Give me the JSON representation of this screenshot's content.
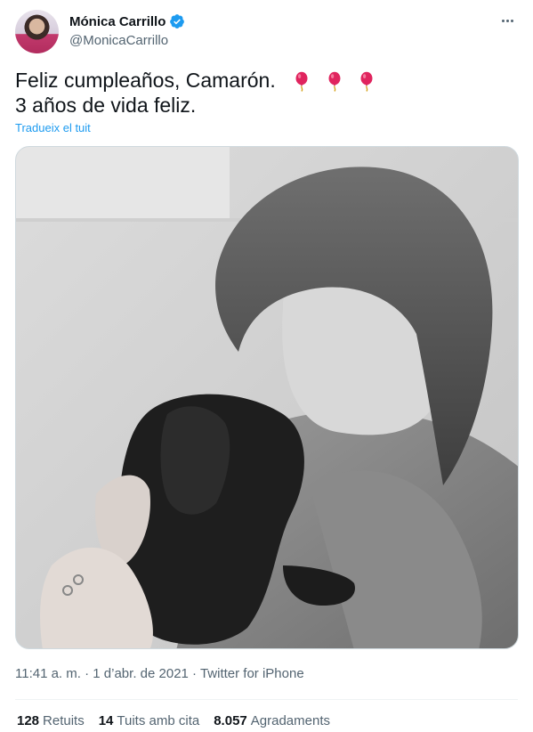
{
  "author": {
    "display_name": "Mónica Carrillo",
    "handle": "@MonicaCarrillo",
    "verified": true
  },
  "tweet": {
    "line1": "Feliz cumpleaños, Camarón.",
    "line2": "3 años de vida feliz.",
    "emoji": [
      "balloon-icon",
      "balloon-icon",
      "balloon-icon"
    ],
    "translate_label": "Tradueix el tuit"
  },
  "meta": {
    "time": "11:41 a. m.",
    "separator1": " · ",
    "date": "1 d’abr. de 2021",
    "separator2": " · ",
    "source": "Twitter for iPhone"
  },
  "stats": {
    "retweets_count": "128",
    "retweets_label": "Retuits",
    "quotes_count": "14",
    "quotes_label": "Tuits amb cita",
    "likes_count": "8.057",
    "likes_label": "Agradaments"
  },
  "colors": {
    "accent": "#1d9bf0",
    "secondary_text": "#536471",
    "primary_text": "#0f1419",
    "balloon": "#e0245e"
  }
}
